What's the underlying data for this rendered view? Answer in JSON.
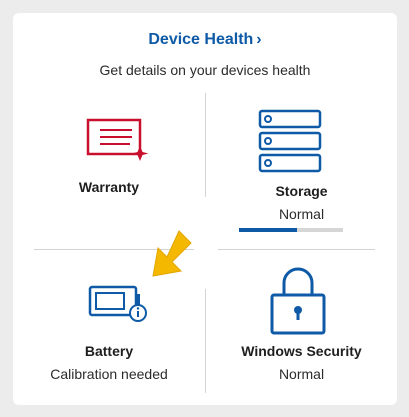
{
  "panel": {
    "title": "Device Health",
    "title_chevron": "›",
    "subtitle": "Get details on your devices health"
  },
  "tiles": {
    "warranty": {
      "label": "Warranty",
      "status": ""
    },
    "storage": {
      "label": "Storage",
      "status": "Normal",
      "usage_fraction": 0.56
    },
    "battery": {
      "label": "Battery",
      "status": "Calibration needed"
    },
    "security": {
      "label": "Windows Security",
      "status": "Normal"
    }
  },
  "icons": {
    "warranty": "warranty-certificate-icon",
    "storage": "storage-drives-icon",
    "battery": "battery-info-icon",
    "security": "padlock-icon",
    "pointer": "yellow-arrow-pointer"
  },
  "colors": {
    "accent_blue": "#0e5aa7",
    "warranty_red": "#c8102e",
    "pointer_yellow": "#f5b800",
    "bar_track": "#d6d6d6"
  }
}
